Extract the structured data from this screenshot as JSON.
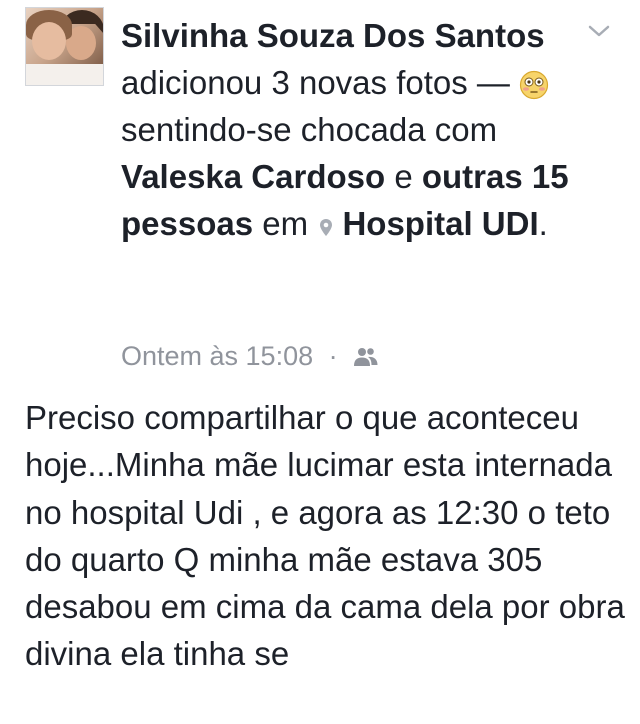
{
  "post": {
    "author": "Silvinha Souza Dos Santos",
    "action": "adicionou 3 novas fotos —",
    "feeling_emoji": "flushed-face-icon",
    "feeling": "sentindo-se chocada",
    "with_word": "com",
    "tagged_person": "Valeska Cardoso",
    "and_word": "e",
    "others": "outras 15 pessoas",
    "at_word": "em",
    "location_icon": "location-pin-icon",
    "location": "Hospital UDI",
    "period": ".",
    "timestamp": "Ontem às 15:08",
    "separator": "·",
    "privacy_icon": "friends-icon",
    "menu_icon": "chevron-down-icon",
    "body": "Preciso compartilhar o que aconteceu hoje...Minha mãe lucimar esta internada no hospital Udi , e agora as 12:30 o teto do quarto Q minha mãe estava 305 desabou em cima da cama dela por obra divina ela tinha se"
  }
}
